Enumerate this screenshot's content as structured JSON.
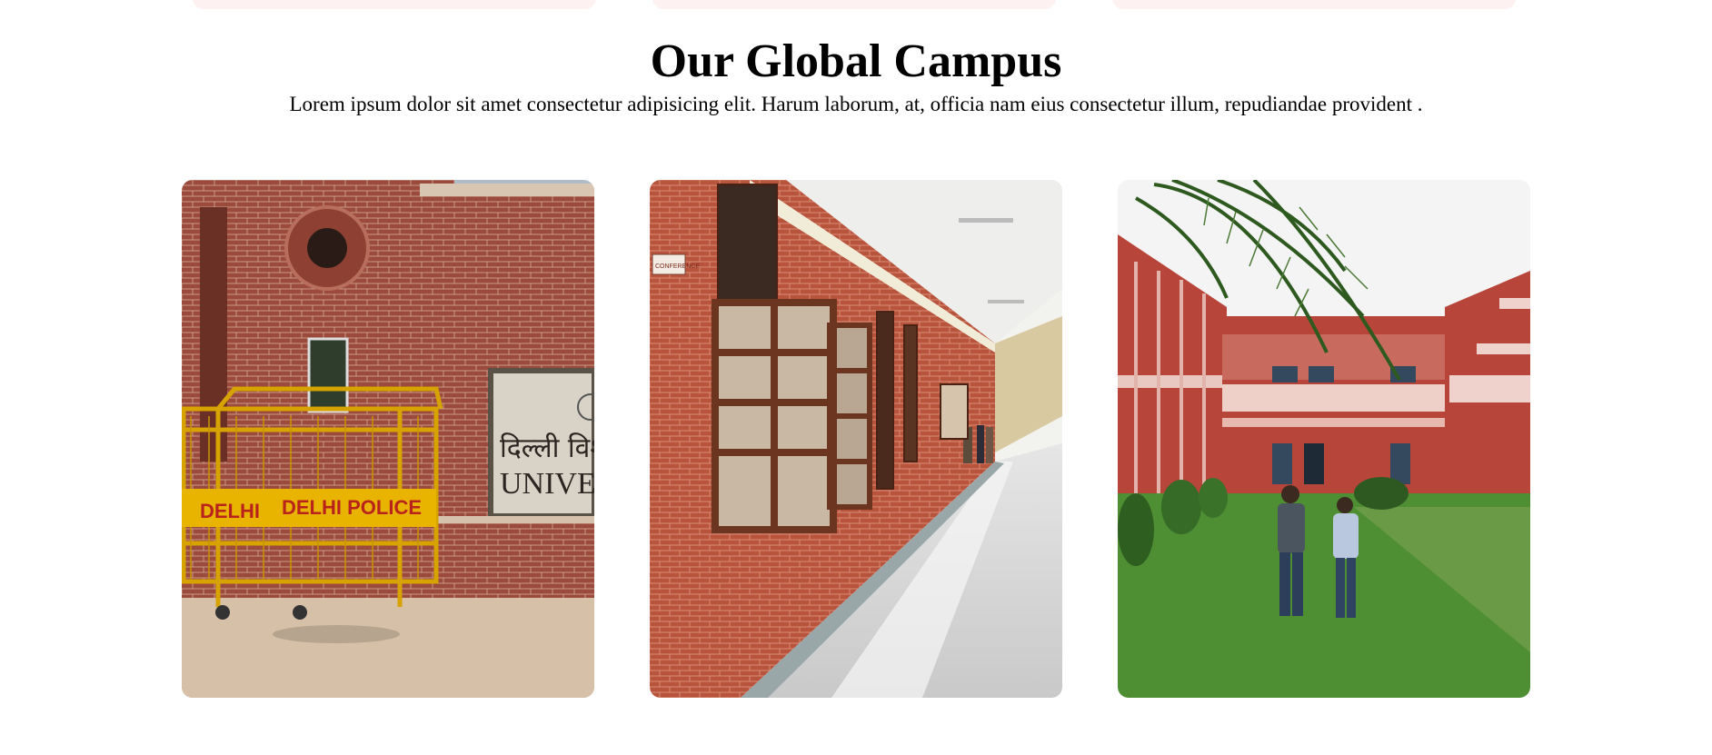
{
  "section": {
    "title": "Our Global Campus",
    "description": "Lorem ipsum dolor sit amet consectetur adipisicing elit. Harum laborum, at, officia nam eius consectetur illum, repudiandae provident ."
  },
  "photos": [
    {
      "name": "campus-gate",
      "sign_hindi": "दिल्ली विश",
      "sign_english": "UNIVERSIT",
      "barricade_text_left": "DELHI",
      "barricade_text_right": "DELHI POLICE"
    },
    {
      "name": "campus-corridor",
      "door_label": "CONFERENCE"
    },
    {
      "name": "campus-courtyard"
    }
  ],
  "colors": {
    "card_pink": "#fdf1f1",
    "brick": "#a24a3a",
    "lawn": "#4f8f34"
  }
}
